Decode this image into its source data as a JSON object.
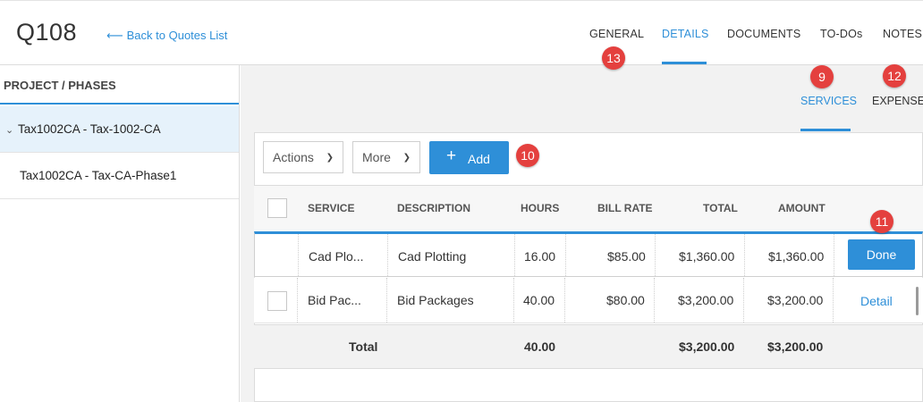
{
  "header": {
    "quote_id": "Q108",
    "back_link": "Back to Quotes List",
    "tabs": [
      "GENERAL",
      "DETAILS",
      "DOCUMENTS",
      "TO-DOs",
      "NOTES"
    ],
    "active_tab": "DETAILS"
  },
  "annotations": {
    "general": "13",
    "services": "9",
    "expense": "12",
    "add": "10",
    "done": "11"
  },
  "left_panel": {
    "header": "PROJECT / PHASES",
    "items": [
      "Tax1002CA - Tax-1002-CA",
      "Tax1002CA - Tax-CA-Phase1"
    ],
    "selected_index": 0
  },
  "sub_tabs": [
    "SERVICES",
    "EXPENSE"
  ],
  "toolbar": {
    "actions_label": "Actions",
    "more_label": "More",
    "add_label": "Add"
  },
  "table": {
    "columns": [
      "SERVICE",
      "DESCRIPTION",
      "HOURS",
      "BILL RATE",
      "TOTAL",
      "AMOUNT"
    ],
    "rows": [
      {
        "service": "Cad Plo...",
        "description": "Cad Plotting",
        "hours": "16.00",
        "bill_rate": "$85.00",
        "total": "$1,360.00",
        "amount": "$1,360.00",
        "action": "Done"
      },
      {
        "service": "Bid Pac...",
        "description": "Bid Packages",
        "hours": "40.00",
        "bill_rate": "$80.00",
        "total": "$3,200.00",
        "amount": "$3,200.00",
        "action": "Detail"
      }
    ],
    "totals": {
      "label": "Total",
      "hours": "40.00",
      "total": "$3,200.00",
      "amount": "$3,200.00"
    }
  },
  "colors": {
    "accent": "#2e8fd8",
    "badge": "#e4403e",
    "selected_bg": "#e6f2fb"
  }
}
